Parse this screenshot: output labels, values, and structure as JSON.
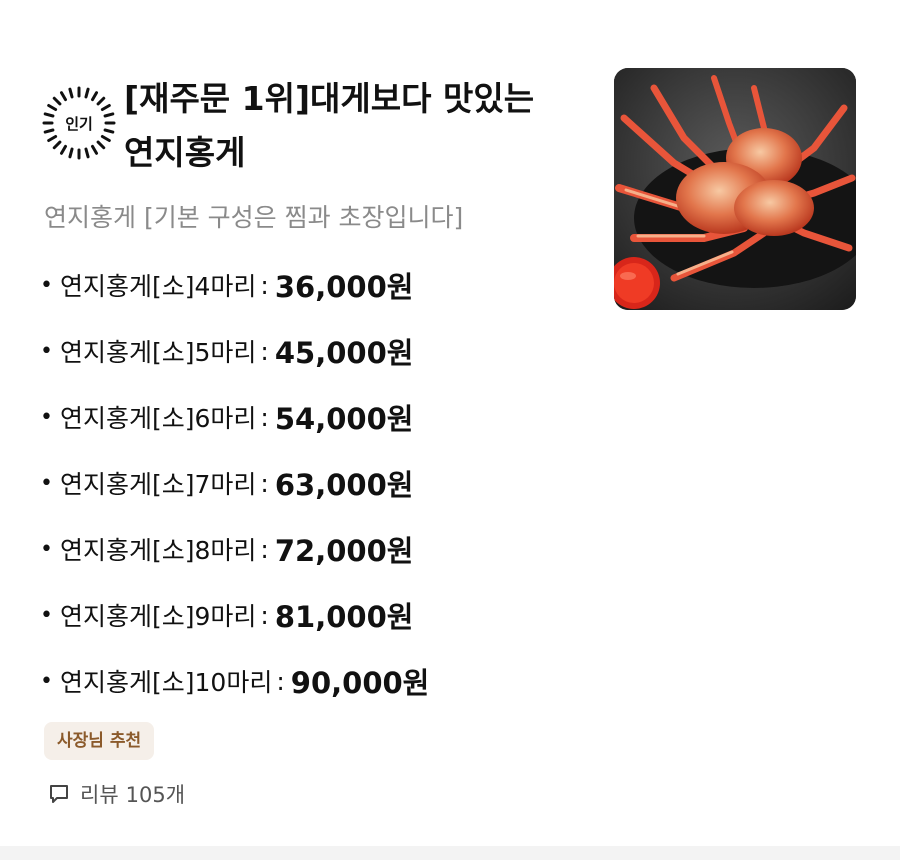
{
  "menu": {
    "badge": {
      "label": "인기",
      "icon": "sunburst-badge-icon"
    },
    "title_line1": "[재주문 1위]대게보다 맛있는",
    "title_line2": "연지홍게",
    "description": "연지홍게 [기본 구성은 찜과 초장입니다]",
    "options": [
      {
        "name": "연지홍게[소]4마리",
        "price": "36,000원"
      },
      {
        "name": "연지홍게[소]5마리",
        "price": "45,000원"
      },
      {
        "name": "연지홍게[소]6마리",
        "price": "54,000원"
      },
      {
        "name": "연지홍게[소]7마리",
        "price": "63,000원"
      },
      {
        "name": "연지홍게[소]8마리",
        "price": "72,000원"
      },
      {
        "name": "연지홍게[소]9마리",
        "price": "81,000원"
      },
      {
        "name": "연지홍게[소]10마리",
        "price": "90,000원"
      }
    ],
    "bullet": "•",
    "separator": ":",
    "tag": "사장님 추천",
    "review_label": "리뷰",
    "review_count": "105개",
    "photo_icon": "red-snow-crab-photo",
    "colors": {
      "tag_bg": "#f5efe9",
      "tag_text": "#8b5a2b",
      "description": "#8a8a8a",
      "crab": "#e8553a"
    }
  }
}
